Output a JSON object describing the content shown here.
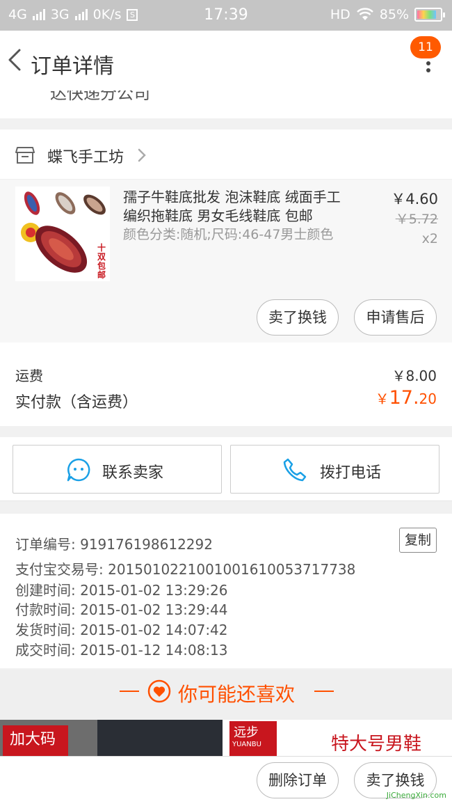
{
  "status_bar": {
    "network1": "4G",
    "network2": "3G",
    "speed": "0K/s",
    "s_icon": "S",
    "time": "17:39",
    "hd": "HD",
    "battery_text": "85%",
    "battery_level": 0.85
  },
  "header": {
    "title": "订单详情",
    "badge": "11"
  },
  "previous_line": "达快递分公司",
  "shop": {
    "name": "蝶飞手工坊"
  },
  "item": {
    "title": "孺子牛鞋底批发 泡沫鞋底 绒面手工编织拖鞋底 男女毛线鞋底 包邮",
    "spec": "颜色分类:随机;尺码:46-47男士颜色",
    "price": "￥4.60",
    "original_price": "￥5.72",
    "quantity": "x2",
    "thumb_text": "十双包邮",
    "sell_label": "卖了换钱",
    "after_sale_label": "申请售后"
  },
  "fees": {
    "shipping_label": "运费",
    "shipping_value": "￥8.00",
    "total_label": "实付款（含运费）",
    "total_symbol": "￥",
    "total_int": "17.",
    "total_dec": "20"
  },
  "contact": {
    "seller_label": "联系卖家",
    "phone_label": "拨打电话"
  },
  "order_info": {
    "copy_label": "复制",
    "rows": [
      "订单编号: 919176198612292",
      "支付宝交易号: 2015010221001001610053717738",
      "创建时间: 2015-01-02 13:29:26",
      "付款时间: 2015-01-02 13:29:44",
      "发货时间: 2015-01-02 14:07:42",
      "成交时间: 2015-01-12 14:08:13"
    ]
  },
  "recommend": {
    "title": "你可能还喜欢"
  },
  "ads": {
    "ad1_text": "加大码",
    "ad2_logo": "远步",
    "ad2_logo_sub": "YUANBU",
    "ad2_text": "特大号男鞋"
  },
  "bottom": {
    "delete_label": "删除订单",
    "sell_label": "卖了换钱",
    "watermark": "JiChengXin.com"
  },
  "colors": {
    "accent": "#ff5000",
    "badge": "#ff5a00",
    "icon_blue": "#1aa0e6"
  }
}
